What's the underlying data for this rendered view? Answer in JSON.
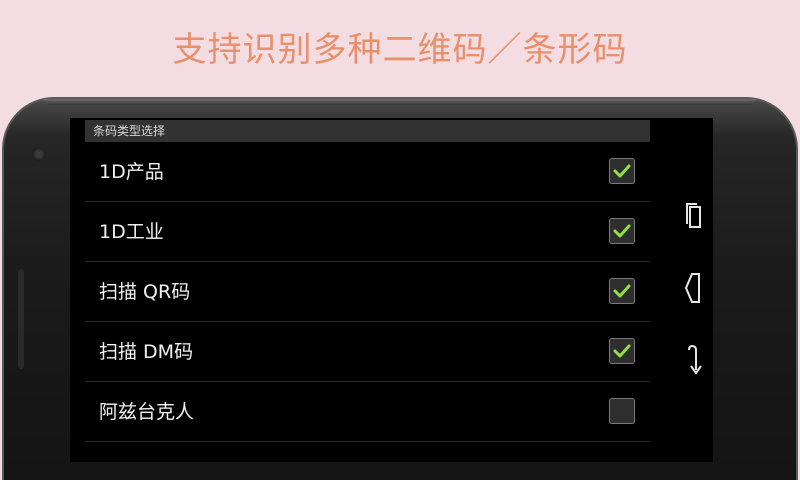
{
  "headline": "支持识别多种二维码／条形码",
  "screen": {
    "section_title": "条码类型选择",
    "options": [
      {
        "label": "1D产品",
        "checked": true
      },
      {
        "label": "1D工业",
        "checked": true
      },
      {
        "label": "扫描 QR码",
        "checked": true
      },
      {
        "label": "扫描 DM码",
        "checked": true
      },
      {
        "label": "阿兹台克人",
        "checked": false
      }
    ]
  },
  "navbar": {
    "icons": [
      "recent-apps-icon",
      "home-icon",
      "back-icon"
    ]
  },
  "colors": {
    "background": "#f3dde3",
    "headline": "#e8906a",
    "check": "#8fe040"
  }
}
